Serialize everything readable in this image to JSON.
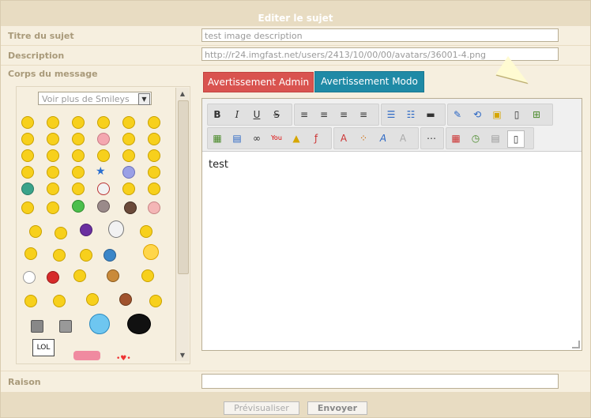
{
  "header": {
    "title": "Editer le sujet"
  },
  "form": {
    "title_label": "Titre du sujet",
    "title_value": "test image description",
    "description_label": "Description",
    "description_value": "http://r24.imgfast.net/users/2413/10/00/00/avatars/36001-4.png",
    "body_label": "Corps du message",
    "reason_label": "Raison",
    "reason_value": ""
  },
  "smileys": {
    "select_label": "Voir plus de Smileys"
  },
  "buttons": {
    "admin_warning": "Avertissement Admin",
    "modo_warning": "Avertissement Modo",
    "preview": "Prévisualiser",
    "send": "Envoyer"
  },
  "editor": {
    "content": "test"
  },
  "colors": {
    "admin_btn": "#d9534f",
    "modo_btn": "#1f8aa6",
    "title_bar": "#e8dcc2"
  }
}
